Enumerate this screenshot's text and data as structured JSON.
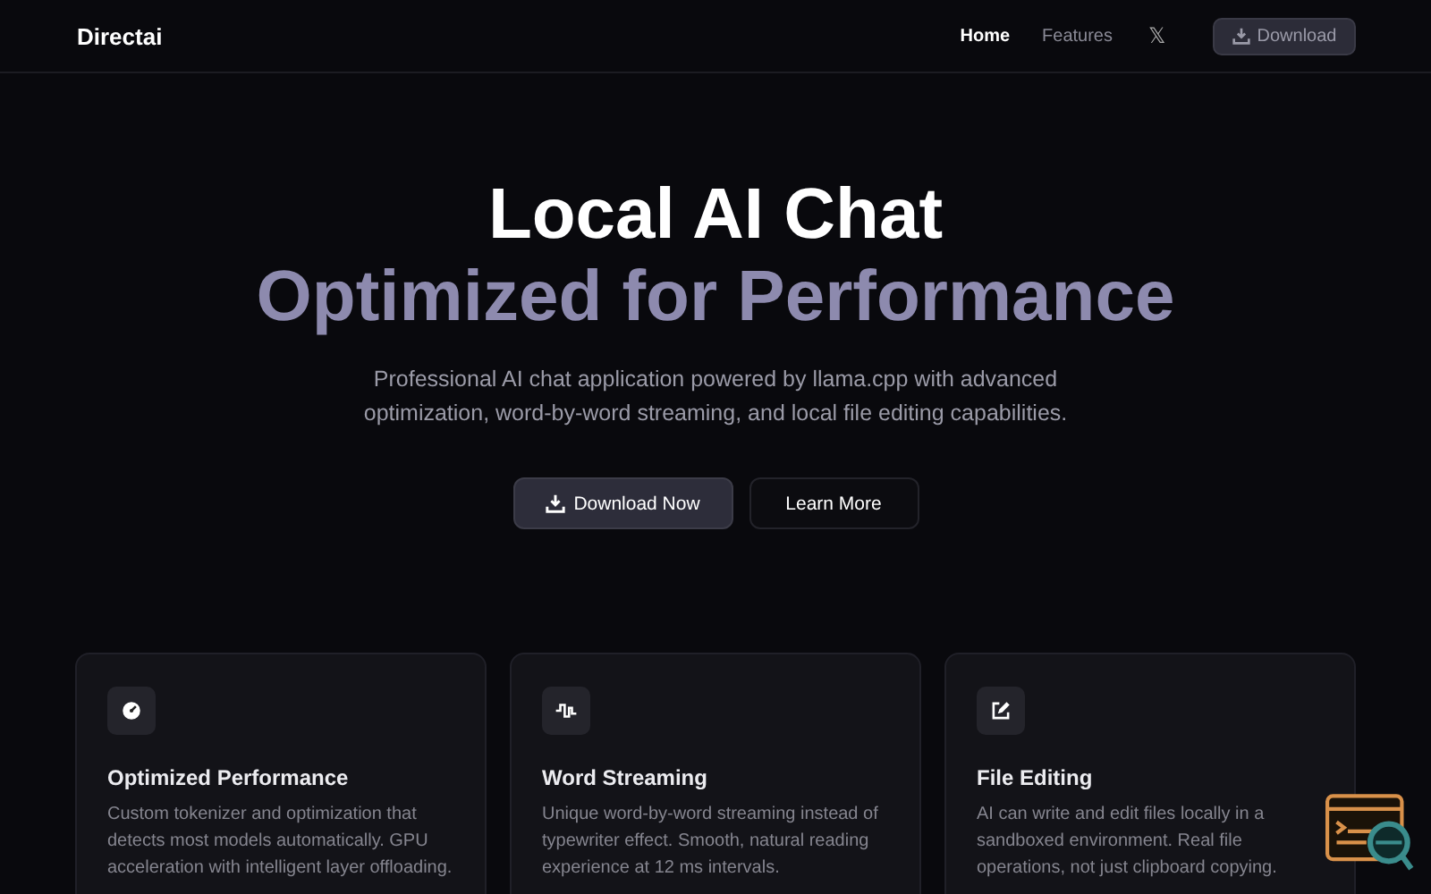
{
  "header": {
    "brand": "Directai",
    "nav": [
      {
        "label": "Home",
        "selected": true
      },
      {
        "label": "Features",
        "selected": false
      }
    ],
    "social": "𝕏",
    "download_button": "Download"
  },
  "hero": {
    "title": "Local AI Chat",
    "subtitle": "Optimized for Performance",
    "description": "Professional AI chat application powered by llama.cpp with advanced optimization, word-by-word streaming, and local file editing capabilities.",
    "buttons": [
      {
        "label": "Download Now",
        "kind": "primary"
      },
      {
        "label": "Learn More",
        "kind": "secondary"
      }
    ]
  },
  "features": [
    {
      "kind": "gauge",
      "title": "Optimized Performance",
      "text": "Custom tokenizer and optimization that detects most models automatically. GPU acceleration with intelligent layer offloading."
    },
    {
      "kind": "wave",
      "title": "Word Streaming",
      "text": "Unique word-by-word streaming instead of typewriter effect. Smooth, natural reading experience at 12 ms intervals."
    },
    {
      "kind": "edit",
      "title": "File Editing",
      "text": "AI can write and edit files locally in a sandboxed environment. Real file operations, not just clipboard copying."
    }
  ]
}
